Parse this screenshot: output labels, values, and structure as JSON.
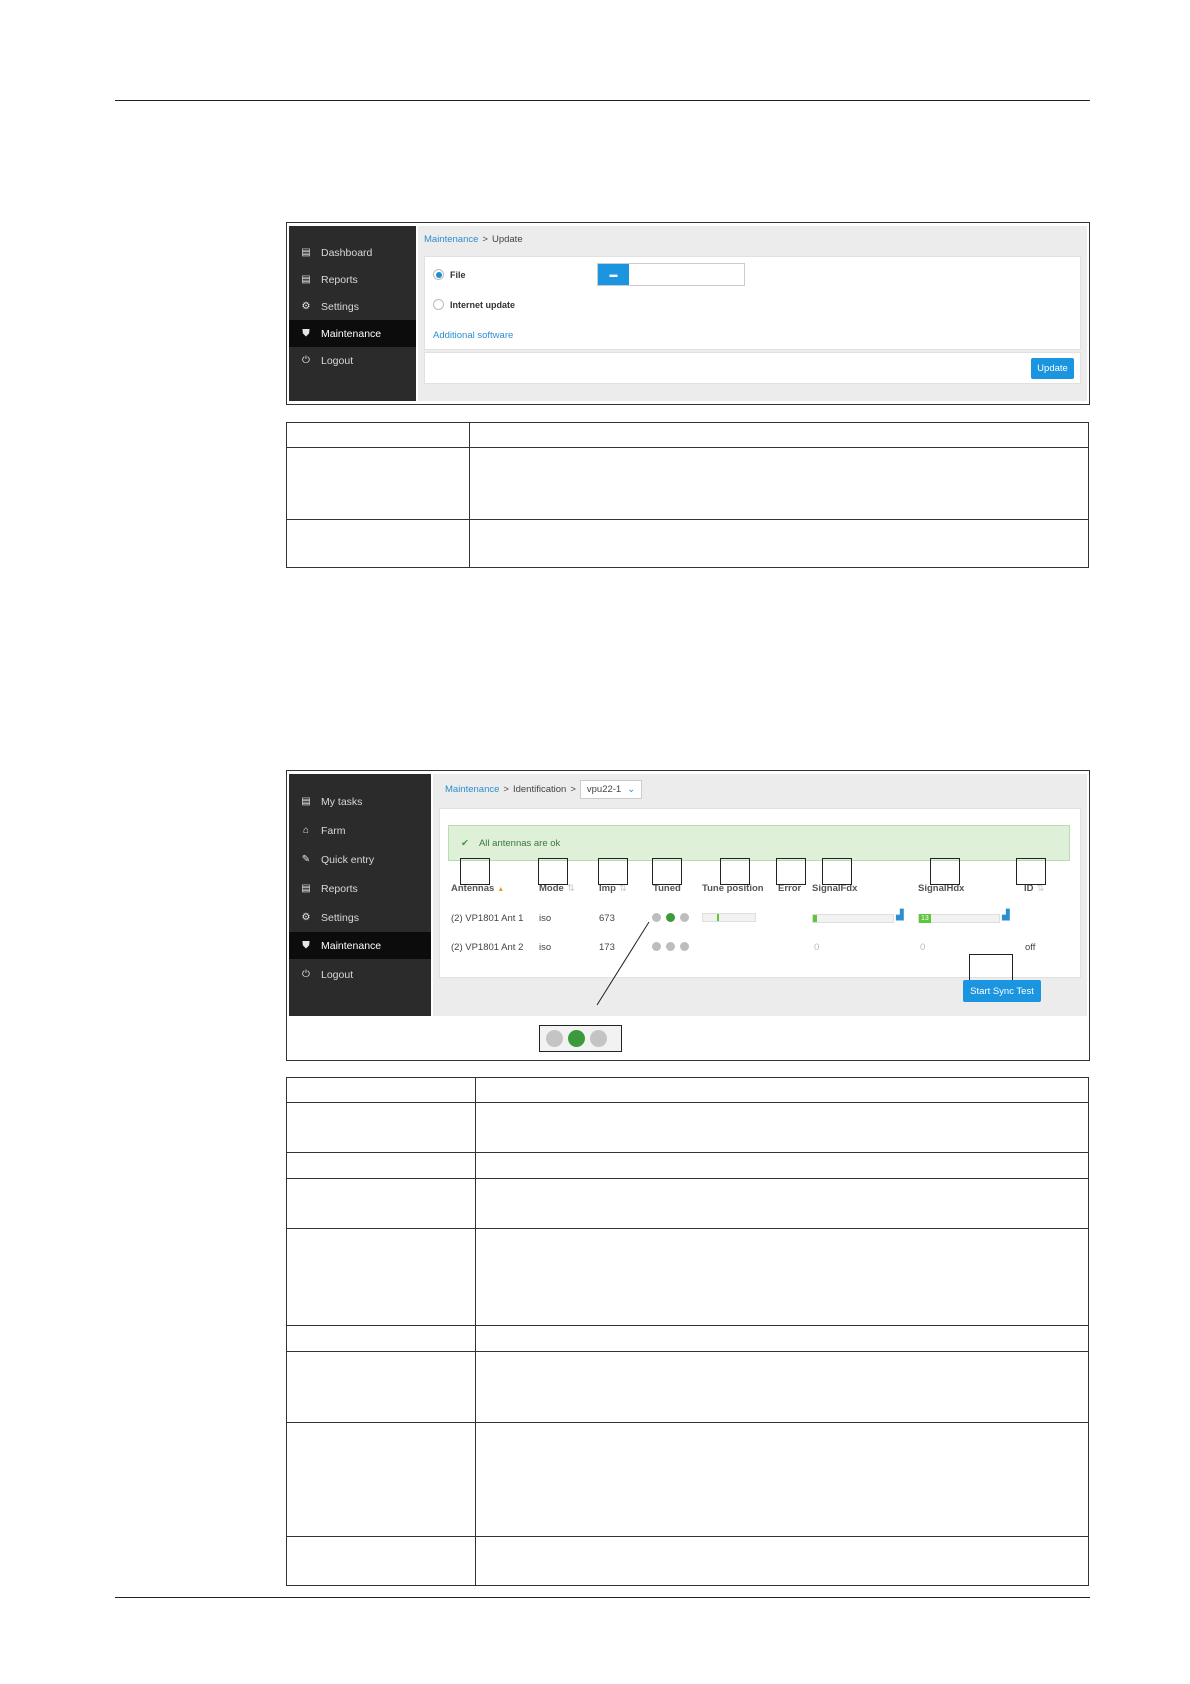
{
  "screen1": {
    "sidebar": [
      {
        "icon": "list-icon",
        "glyph": "▤",
        "label": "Dashboard",
        "active": false
      },
      {
        "icon": "report-icon",
        "glyph": "▤",
        "label": "Reports",
        "active": false
      },
      {
        "icon": "gears-icon",
        "glyph": "⚙",
        "label": "Settings",
        "active": false
      },
      {
        "icon": "shield-icon",
        "glyph": "⛊",
        "label": "Maintenance",
        "active": true
      },
      {
        "icon": "power-icon",
        "glyph": "⏻",
        "label": "Logout",
        "active": false
      }
    ],
    "breadcrumb": {
      "link": "Maintenance",
      "sep": ">",
      "current": "Update"
    },
    "options": [
      {
        "label": "File",
        "selected": true
      },
      {
        "label": "Internet update",
        "selected": false
      }
    ],
    "folder_glyph": "▬",
    "additional_link": "Additional software",
    "update_button": "Update"
  },
  "screen2": {
    "sidebar": [
      {
        "icon": "list-icon",
        "glyph": "▤",
        "label": "My tasks",
        "active": false
      },
      {
        "icon": "home-icon",
        "glyph": "⌂",
        "label": "Farm",
        "active": false
      },
      {
        "icon": "edit-icon",
        "glyph": "✎",
        "label": "Quick entry",
        "active": false
      },
      {
        "icon": "report-icon",
        "glyph": "▤",
        "label": "Reports",
        "active": false
      },
      {
        "icon": "gears-icon",
        "glyph": "⚙",
        "label": "Settings",
        "active": false
      },
      {
        "icon": "shield-icon",
        "glyph": "⛊",
        "label": "Maintenance",
        "active": true
      },
      {
        "icon": "power-icon",
        "glyph": "⏻",
        "label": "Logout",
        "active": false
      }
    ],
    "breadcrumb": {
      "link": "Maintenance",
      "sep": ">",
      "current": "Identification",
      "select_value": "vpu22-1",
      "chevron": "⌄"
    },
    "alert": {
      "icon": "✔",
      "text": "All antennas are ok"
    },
    "columns": {
      "antennas": "Antennas",
      "mode": "Mode",
      "imp": "Imp",
      "tuned": "Tuned",
      "tune_position": "Tune position",
      "error": "Error",
      "signal_fdx": "SignalFdx",
      "signal_hdx": "SignalHdx",
      "id": "ID"
    },
    "sort_glyph": "⇅",
    "sort_asc_glyph": "▲",
    "chart_glyph": "▟",
    "rows": [
      {
        "antenna": "(2) VP1801 Ant 1",
        "mode": "iso",
        "imp": "673",
        "tuned": [
          false,
          true,
          false
        ],
        "tune_position_fraction": 0.28,
        "signal_fdx": "",
        "signal_fdx_fraction": 0.04,
        "signal_hdx": "13",
        "signal_hdx_fraction": 0.12,
        "id": ""
      },
      {
        "antenna": "(2) VP1801 Ant 2",
        "mode": "iso",
        "imp": "173",
        "tuned": [
          false,
          false,
          false
        ],
        "signal_fdx": "0",
        "signal_hdx": "0",
        "id": "off"
      }
    ],
    "sync_button": "Start Sync Test"
  }
}
